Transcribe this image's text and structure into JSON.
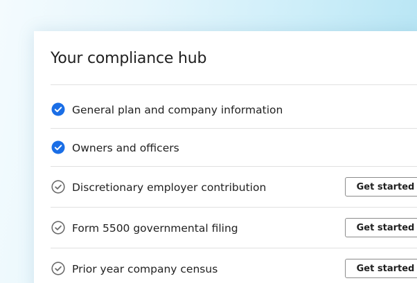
{
  "hub": {
    "title": "Your compliance hub",
    "items": [
      {
        "label": "General plan and company information",
        "status": "complete",
        "icon": "check-circle-filled-icon"
      },
      {
        "label": "Owners and officers",
        "status": "complete",
        "icon": "check-circle-filled-icon"
      },
      {
        "label": "Discretionary employer contribution",
        "status": "incomplete",
        "icon": "check-circle-outline-icon",
        "button": "Get started"
      },
      {
        "label": "Form 5500 governmental filing",
        "status": "incomplete",
        "icon": "check-circle-outline-icon",
        "button": "Get started"
      },
      {
        "label": "Prior year company census",
        "status": "incomplete",
        "icon": "check-circle-outline-icon",
        "button": "Get started"
      }
    ]
  },
  "colors": {
    "complete": "#1a6ee6",
    "incomplete": "#6b6b6b",
    "divider": "#e0e0e0"
  }
}
